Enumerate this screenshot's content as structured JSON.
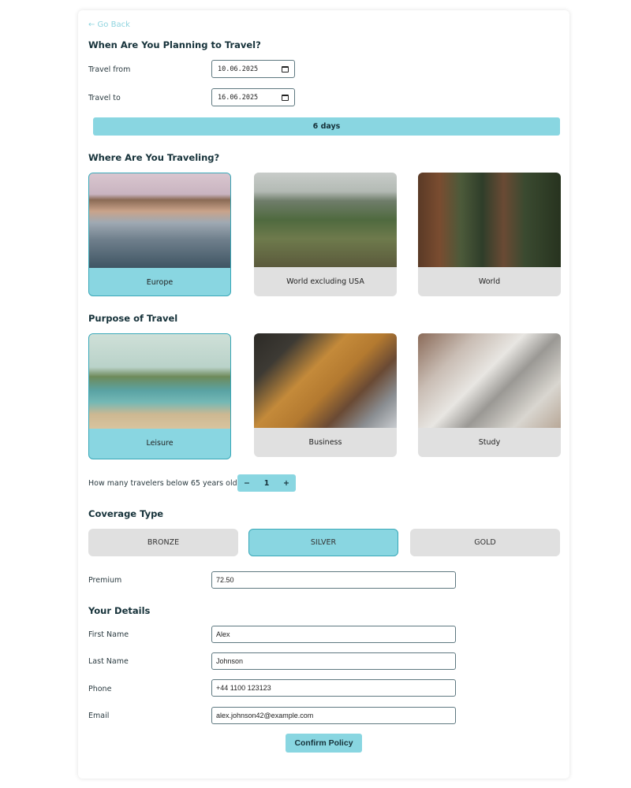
{
  "nav": {
    "back_label": "← Go Back"
  },
  "dates": {
    "heading": "When Are You Planning to Travel?",
    "from_label": "Travel from",
    "from_value": "10.06.2025",
    "to_label": "Travel to",
    "to_value": "16.06.2025",
    "duration": "6 days"
  },
  "destination": {
    "heading": "Where Are You Traveling?",
    "options": [
      {
        "label": "Europe",
        "selected": true
      },
      {
        "label": "World excluding USA",
        "selected": false
      },
      {
        "label": "World",
        "selected": false
      }
    ]
  },
  "purpose": {
    "heading": "Purpose of Travel",
    "options": [
      {
        "label": "Leisure",
        "selected": true
      },
      {
        "label": "Business",
        "selected": false
      },
      {
        "label": "Study",
        "selected": false
      }
    ]
  },
  "travelers": {
    "label": "How many travelers below 65 years old?",
    "minus": "−",
    "count": "1",
    "plus": "+"
  },
  "coverage": {
    "heading": "Coverage Type",
    "options": [
      {
        "label": "BRONZE",
        "selected": false
      },
      {
        "label": "SILVER",
        "selected": true
      },
      {
        "label": "GOLD",
        "selected": false
      }
    ],
    "premium_label": "Premium",
    "premium_value": "72.50"
  },
  "details": {
    "heading": "Your Details",
    "first_name_label": "First Name",
    "first_name": "Alex",
    "last_name_label": "Last Name",
    "last_name": "Johnson",
    "phone_label": "Phone",
    "phone": "+44 1100 123123",
    "email_label": "Email",
    "email": "alex.johnson42@example.com"
  },
  "actions": {
    "confirm_label": "Confirm Policy"
  },
  "colors": {
    "accent": "#89d6e1",
    "accent_border": "#3aa8b8",
    "unselected": "#e0e0e0",
    "heading": "#16323a"
  }
}
